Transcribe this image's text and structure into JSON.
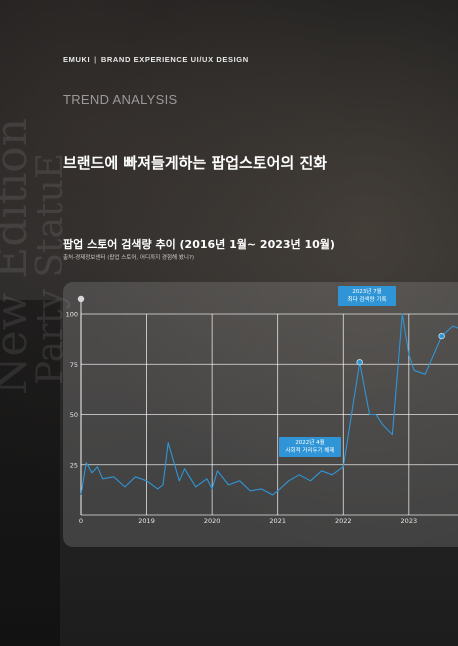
{
  "header": {
    "brand": "EMUKI",
    "tagline": "BRAND EXPERIENCE UI/UX DESIGN"
  },
  "section_label": "TREND ANALYSIS",
  "main_title": "브랜드에 빠져들게하는 팝업스토어의 진화",
  "background_text": [
    "New Edition",
    "Party StatuE"
  ],
  "chart": {
    "title": "팝업 스토어 검색량 추이 (2016년 1월~ 2023년 10월)",
    "source": "출처-경제정보센터 (팝업 스토어, 어디까지 경험해 봤니?)",
    "annotations": [
      {
        "x": 2022.25,
        "text": [
          "2022년 4월",
          "사회적 거리두기 해제"
        ]
      },
      {
        "x": 2023.5,
        "text": [
          "2023년 7월",
          "최다 검색량 기록"
        ]
      }
    ]
  },
  "chart_data": {
    "type": "line",
    "title": "팝업 스토어 검색량 추이 (2016년 1월~ 2023년 10월)",
    "xlabel": "",
    "ylabel": "",
    "xlim": [
      2018,
      2023.75
    ],
    "ylim": [
      0,
      100
    ],
    "x_ticks": [
      {
        "x": 2018,
        "label": "0"
      },
      {
        "x": 2019,
        "label": "2019"
      },
      {
        "x": 2020,
        "label": "2020"
      },
      {
        "x": 2021,
        "label": "2021"
      },
      {
        "x": 2022,
        "label": "2022"
      },
      {
        "x": 2023,
        "label": "2023"
      }
    ],
    "y_ticks": [
      25,
      50,
      75,
      100
    ],
    "grid": true,
    "line_color": "#2f95d6",
    "series": [
      {
        "x": [
          2018.0,
          2018.08,
          2018.17,
          2018.25,
          2018.33,
          2018.5,
          2018.67,
          2018.83,
          2019.0,
          2019.17,
          2019.25,
          2019.33,
          2019.5,
          2019.58,
          2019.75,
          2019.92,
          2020.0,
          2020.08,
          2020.25,
          2020.42,
          2020.58,
          2020.75,
          2020.92,
          2021.0,
          2021.17,
          2021.33,
          2021.5,
          2021.67,
          2021.83,
          2022.0,
          2022.25,
          2022.4,
          2022.5,
          2022.6,
          2022.75,
          2022.9,
          2023.0,
          2023.08,
          2023.25,
          2023.5,
          2023.67,
          2023.75
        ],
        "y": [
          10,
          26,
          21,
          24,
          18,
          19,
          14,
          19,
          17,
          13,
          15,
          36,
          17,
          23,
          14,
          18,
          13,
          22,
          15,
          17,
          12,
          13,
          10,
          12,
          17,
          20,
          17,
          22,
          20,
          24,
          76,
          50,
          50,
          45,
          40,
          100,
          80,
          72,
          70,
          89,
          94,
          93
        ]
      }
    ]
  }
}
